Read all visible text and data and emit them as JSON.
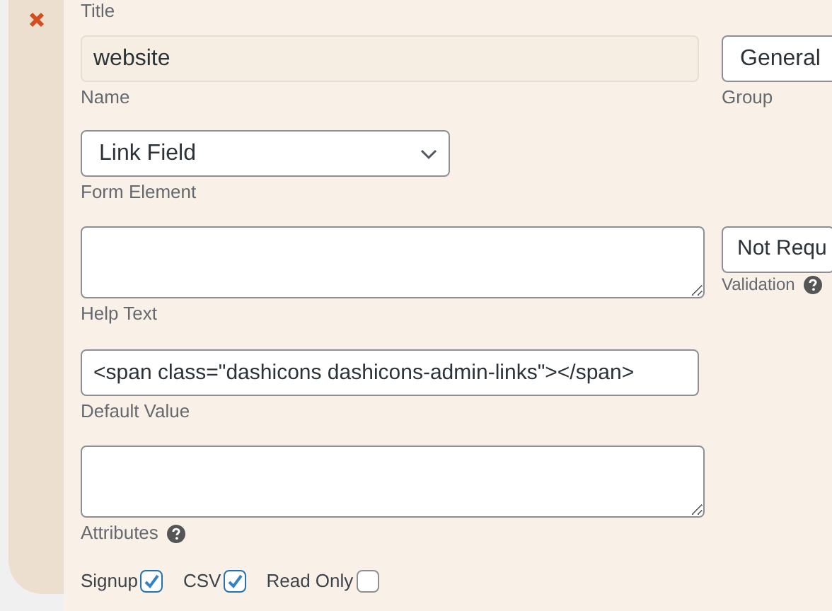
{
  "title_label": "Title",
  "name": {
    "value": "website",
    "label": "Name"
  },
  "group": {
    "value": "General",
    "label": "Group"
  },
  "form_element": {
    "value": "Link Field",
    "label": "Form Element"
  },
  "help_text": {
    "label": "Help Text"
  },
  "validation": {
    "value": "Not Requ",
    "label": "Validation"
  },
  "default_value": {
    "value": "<span class=\"dashicons dashicons-admin-links\"></span>",
    "label": "Default Value"
  },
  "attributes": {
    "label": "Attributes"
  },
  "options": [
    {
      "label": "Signup",
      "checked": true
    },
    {
      "label": "CSV",
      "checked": true
    },
    {
      "label": "Read Only",
      "checked": false
    }
  ]
}
